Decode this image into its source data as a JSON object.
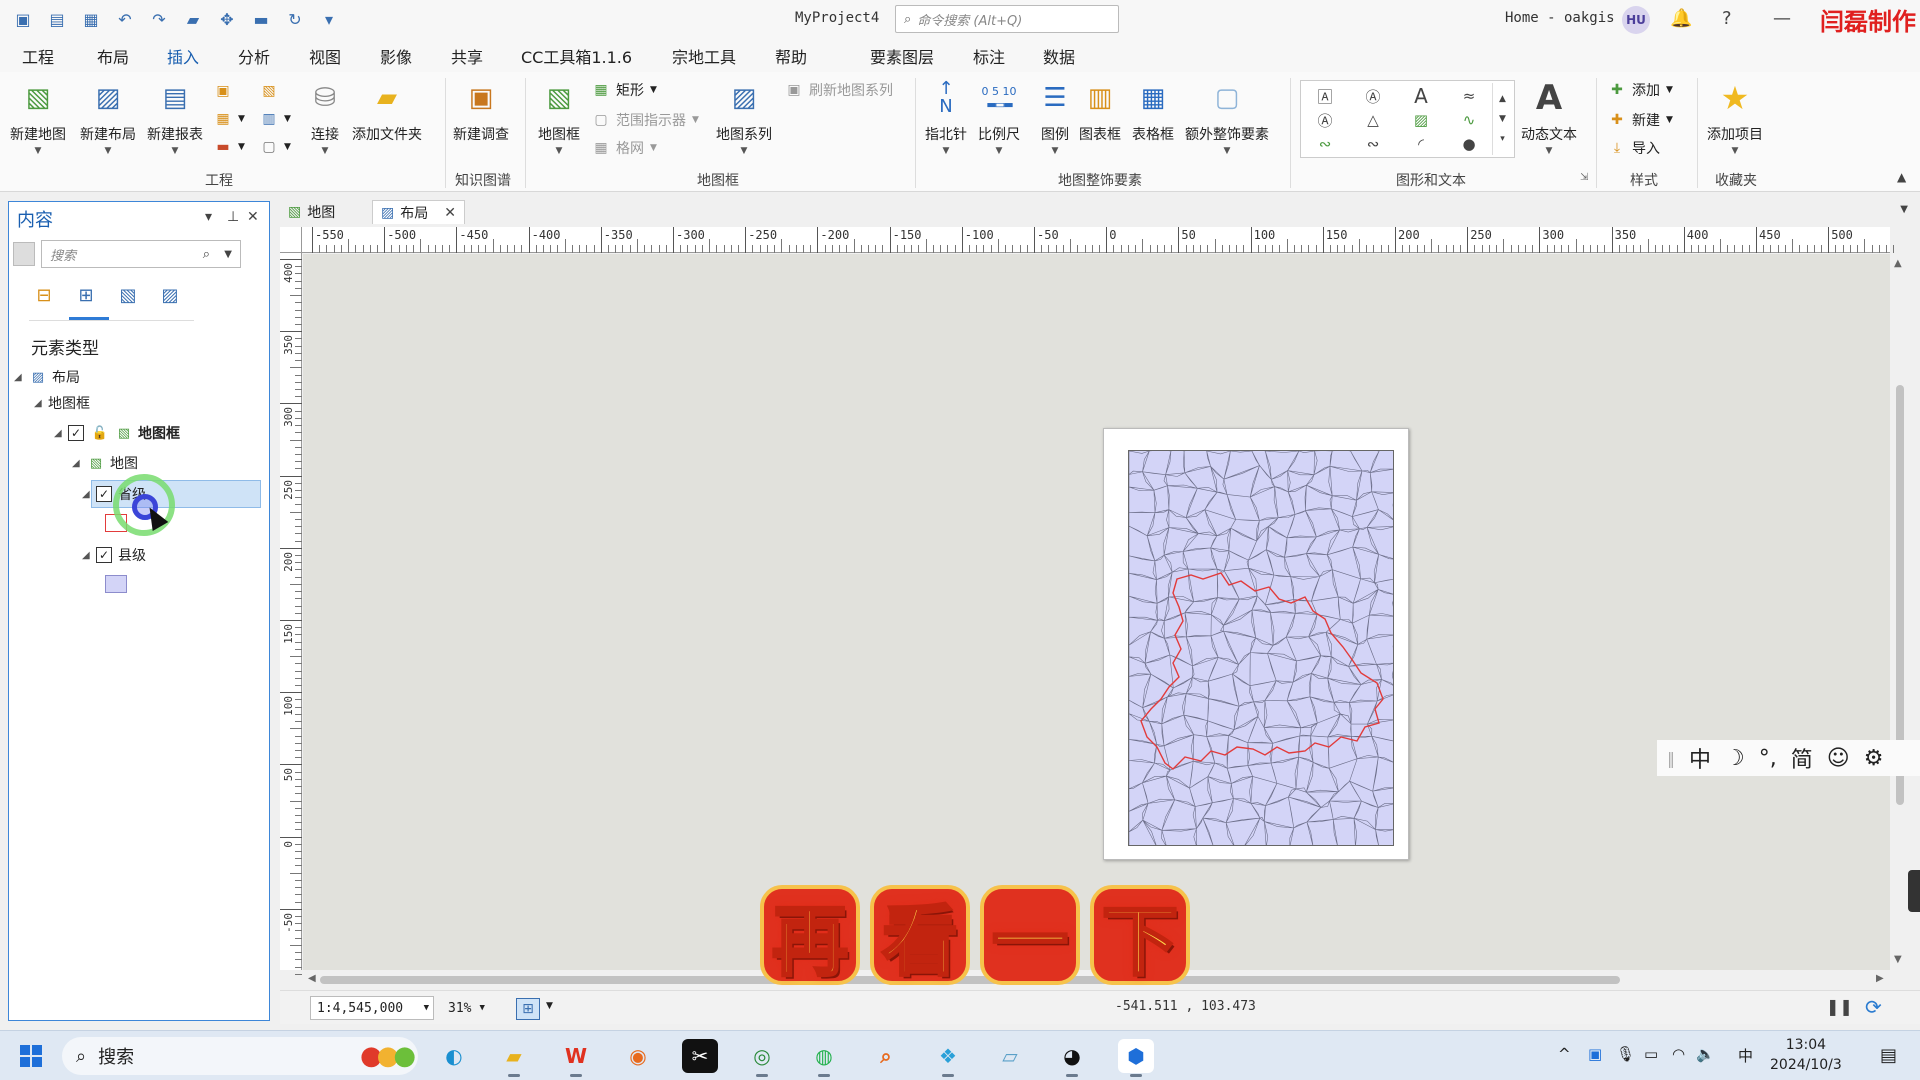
{
  "titlebar": {
    "project": "MyProject4",
    "search_placeholder": "命令搜索 (Alt+Q)",
    "home_user": "Home - oakgis",
    "avatar": "HU",
    "watermark": "闫磊制作",
    "help": "?"
  },
  "tabs": [
    "工程",
    "布局",
    "插入",
    "分析",
    "视图",
    "影像",
    "共享",
    "CC工具箱1.1.6",
    "宗地工具",
    "帮助",
    "要素图层",
    "标注",
    "数据"
  ],
  "ribbon": {
    "project_group": {
      "label": "工程",
      "new_map": "新建地图",
      "new_layout": "新建布局",
      "new_report": "新建报表",
      "connect": "连接",
      "add_folder": "添加文件夹"
    },
    "kb_group": {
      "label": "知识图谱",
      "new_survey": "新建调查"
    },
    "mapframe_group": {
      "label": "地图框",
      "map_frame": "地图框",
      "rectangle": "矩形",
      "extent_indicator": "范围指示器",
      "grid": "格网",
      "map_series": "地图系列",
      "refresh_series": "刷新地图系列"
    },
    "surround_group": {
      "label": "地图整饰要素",
      "north_arrow": "指北针",
      "scale_bar": "比例尺",
      "scale_bar_ticks": "0 5 10",
      "north_letter": "N",
      "legend": "图例",
      "chart_frame": "图表框",
      "table_frame": "表格框",
      "extra": "额外整饰要素"
    },
    "graphics_group": {
      "label": "图形和文本",
      "dynamic_text": "动态文本"
    },
    "style_group": {
      "label": "样式",
      "add": "添加",
      "new": "新建",
      "import": "导入"
    },
    "favorites_group": {
      "label": "收藏夹",
      "add_item": "添加项目"
    }
  },
  "contents": {
    "title": "内容",
    "search_placeholder": "搜索",
    "section": "元素类型",
    "tree": {
      "layout": "布局",
      "mapframe_cat": "地图框",
      "mapframe": "地图框",
      "map": "地图",
      "layer1": "省级",
      "layer2": "县级"
    },
    "colors": {
      "layer1_outline": "#e23b3b",
      "layer2_fill": "#d3d4f7"
    }
  },
  "view_tabs": {
    "map": "地图",
    "layout": "布局"
  },
  "ruler": {
    "h": [
      "-550",
      "-500",
      "-450",
      "-400",
      "-350",
      "-300",
      "-250",
      "-200",
      "-150",
      "-100",
      "-50",
      "0",
      "50",
      "100",
      "150",
      "200",
      "250",
      "300",
      "350",
      "400",
      "450",
      "500"
    ],
    "v": [
      "400",
      "350",
      "300",
      "250",
      "200",
      "150",
      "100",
      "50",
      "0",
      "-50"
    ]
  },
  "status": {
    "scale": "1:4,545,000",
    "zoom": "31%",
    "coords": "-541.511 , 103.473"
  },
  "ime": [
    "中",
    "☽",
    "°,",
    "简",
    "☺",
    "⚙"
  ],
  "caption": [
    "再",
    "看",
    "一",
    "下"
  ],
  "taskbar": {
    "search": "搜索",
    "time": "13:04",
    "date": "2024/10/3",
    "ime": "中"
  }
}
